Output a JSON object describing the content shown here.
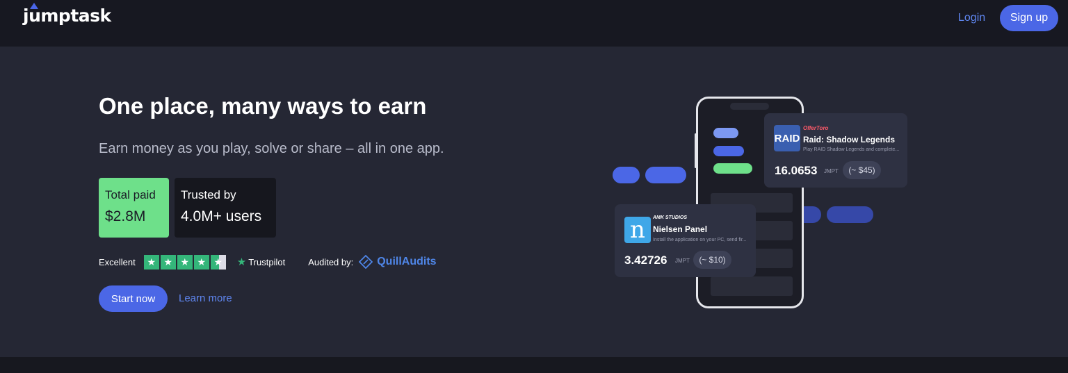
{
  "header": {
    "logo_text": "jumptask",
    "login_label": "Login",
    "signup_label": "Sign up"
  },
  "hero": {
    "title": "One place, many ways to earn",
    "subtitle": "Earn money as you play, solve or share – all in one app.",
    "stats": [
      {
        "label": "Total paid",
        "value": "$2.8M"
      },
      {
        "label": "Trusted by",
        "value": "4.0M+ users"
      }
    ],
    "trust": {
      "rating_word": "Excellent",
      "stars": 4.5,
      "trustpilot_label": "Trustpilot",
      "audited_label": "Audited by:",
      "auditor": "QuillAudits"
    },
    "start_label": "Start now",
    "learn_label": "Learn more"
  },
  "illustration": {
    "cards": [
      {
        "brand": "OfferToro",
        "thumb_text": "RAID",
        "name": "Raid: Shadow Legends",
        "desc": "Play RAID Shadow Legends and complete...",
        "amount": "16.0653",
        "unit": "JMPT",
        "usd": "(~ $45)"
      },
      {
        "brand": "AMK STUDIOS",
        "thumb_text": "n",
        "name": "Nielsen Panel",
        "desc": "Install the application on your PC, send fir...",
        "amount": "3.42726",
        "unit": "JMPT",
        "usd": "(~ $10)"
      }
    ]
  },
  "colors": {
    "accent": "#4b67e6",
    "link": "#5f86f0",
    "green": "#6ee08a",
    "trustpilot_green": "#34b67a",
    "hero_bg": "#252734"
  }
}
